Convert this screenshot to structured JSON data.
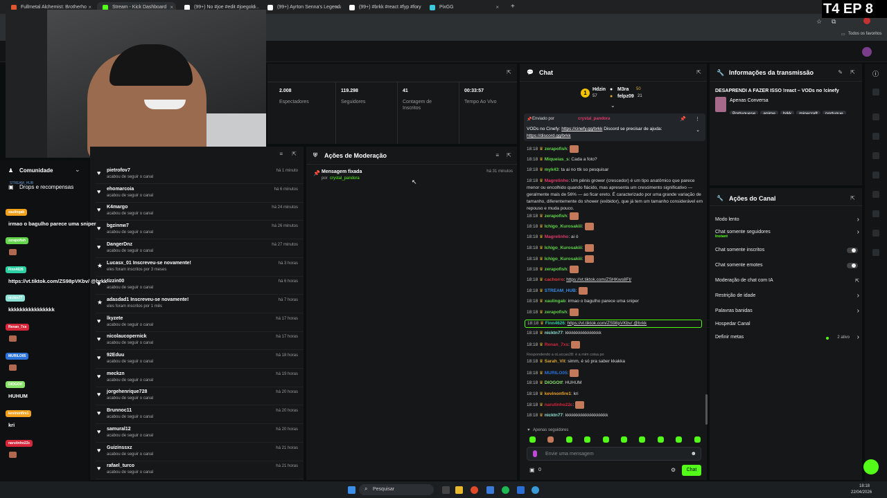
{
  "browser": {
    "tabs": [
      {
        "label": "Fullmetal Alchemist: Brotherho",
        "color": "#e0572f"
      },
      {
        "label": "Stream - Kick Dashboard",
        "color": "#53fc18"
      },
      {
        "label": "(99+) No #joe #edit #joegold...",
        "color": "#ffffff"
      },
      {
        "label": "(99+) Ayrton Senna's Legendar",
        "color": "#ffffff"
      },
      {
        "label": "(99+) #brkk #react #fyp #foryou",
        "color": "#ffffff"
      },
      {
        "label": "PixGG",
        "color": "#3bc9db"
      }
    ],
    "new_tab": "+",
    "bookmarks_label": "Todos os favoritos"
  },
  "overlay": {
    "episode": "T4 EP 8"
  },
  "stats": [
    {
      "value": "2.008",
      "label": "Espectadores"
    },
    {
      "value": "119.298",
      "label": "Seguidores"
    },
    {
      "value": "41",
      "label": "Contagem de Inscritos"
    },
    {
      "value": "00:33:57",
      "label": "Tempo Ao Vivo"
    }
  ],
  "left_sidebar": {
    "community": "Comunidade",
    "drops": "Drops e recompensas",
    "stream_hub": "STREAM_HUB"
  },
  "chat_overlay": [
    {
      "user": "xaulingab",
      "color": "#f2a21c",
      "msg": "irmao o bagulho parece uma sniper"
    },
    {
      "user": "zerapofish",
      "color": "#63d64b",
      "msg": ""
    },
    {
      "user": "Finn4626",
      "color": "#2ed1a3",
      "msg": "https://vt.tiktok.com/ZS98pVKbv/ @brkk"
    },
    {
      "user": "nicktn77",
      "color": "#8fe3d6",
      "msg": "kkkkkkkkkkkkkkkk"
    },
    {
      "user": "Renan_7xs",
      "color": "#d6273a",
      "msg": ""
    },
    {
      "user": "MURILO05",
      "color": "#2b73d8",
      "msg": ""
    },
    {
      "user": "DIOGOtf",
      "color": "#8ae36a",
      "msg": "HUHUM"
    },
    {
      "user": "kevinonfire1",
      "color": "#f2a21c",
      "msg": "kri"
    },
    {
      "user": "narutinho22c",
      "color": "#d6273a",
      "msg": ""
    }
  ],
  "activity": {
    "items": [
      {
        "name": "pietrofov7",
        "sub": "acabou de seguir o canal",
        "time": "há 1 minuto",
        "type": "heart"
      },
      {
        "name": "ehomarcoia",
        "sub": "acabou de seguir o canal",
        "time": "há 6 minutos",
        "type": "heart"
      },
      {
        "name": "K4margo",
        "sub": "acabou de seguir o canal",
        "time": "há 24 minutos",
        "type": "heart"
      },
      {
        "name": "bgzinnw7",
        "sub": "acabou de seguir o canal",
        "time": "há 26 minutos",
        "type": "heart"
      },
      {
        "name": "DangerDnz",
        "sub": "acabou de seguir o canal",
        "time": "há 27 minutos",
        "type": "heart"
      },
      {
        "name": "Lucasx_01 Inscreveu-se novamente!",
        "sub": "eles foram inscritos por 3 meses",
        "time": "há 3 horas",
        "type": "star"
      },
      {
        "name": "tizzin00",
        "sub": "acabou de seguir o canal",
        "time": "há 6 horas",
        "type": "heart"
      },
      {
        "name": "adasdad1 Inscreveu-se novamente!",
        "sub": "eles foram inscritos por 1 mês",
        "time": "há 7 horas",
        "type": "star"
      },
      {
        "name": "lkyzete",
        "sub": "acabou de seguir o canal",
        "time": "há 17 horas",
        "type": "heart"
      },
      {
        "name": "nicolaucopernick",
        "sub": "acabou de seguir o canal",
        "time": "há 17 horas",
        "type": "heart"
      },
      {
        "name": "92Eduu",
        "sub": "acabou de seguir o canal",
        "time": "há 18 horas",
        "type": "heart"
      },
      {
        "name": "meckzn",
        "sub": "acabou de seguir o canal",
        "time": "há 19 horas",
        "type": "heart"
      },
      {
        "name": "jorgehenrique728",
        "sub": "acabou de seguir o canal",
        "time": "há 20 horas",
        "type": "heart"
      },
      {
        "name": "Brunnoc11",
        "sub": "acabou de seguir o canal",
        "time": "há 20 horas",
        "type": "heart"
      },
      {
        "name": "samural12",
        "sub": "acabou de seguir o canal",
        "time": "há 20 horas",
        "type": "heart"
      },
      {
        "name": "Guizinssxz",
        "sub": "acabou de seguir o canal",
        "time": "há 21 horas",
        "type": "heart"
      },
      {
        "name": "rafael_turco",
        "sub": "acabou de seguir o canal",
        "time": "há 21 horas",
        "type": "heart"
      }
    ]
  },
  "moderation": {
    "title": "Ações de Moderação",
    "item_title": "Mensagem fixada",
    "item_by": "por",
    "item_user": "crystal_pandora",
    "item_time": "há 31 minutos"
  },
  "chat": {
    "title": "Chat",
    "leaders": [
      {
        "name": "Hdzin",
        "count": "57",
        "rank": "1"
      },
      {
        "name": "M3ra",
        "count": "50"
      },
      {
        "name": "felpz09",
        "count": "21"
      }
    ],
    "pinned": {
      "label": "Enviado por",
      "user": "crystal_pandora",
      "text": "VODs no Cinefy:",
      "link1": "https://cinefy.gg/brkk",
      "text2": "Discord se precisar de ajuda:",
      "link2": "https://discord.gg/brkk"
    },
    "messages": [
      {
        "time": "18:18",
        "user": "zerapofish",
        "color": "#63d64b",
        "text": "",
        "emote": true
      },
      {
        "time": "18:18",
        "user": "Miqueias_s",
        "color": "#63d64b",
        "text": "Cada a foto?"
      },
      {
        "time": "18:18",
        "user": "myk43",
        "color": "#63d64b",
        "text": "ta ai no ttk so pesquisar"
      },
      {
        "time": "18:18",
        "user": "Magrelinho",
        "color": "#e03a6a",
        "text": "Um pênis grower (crescedor) é um tipo anatômico que parece menor ou encolhido quando flácido, mas apresenta um crescimento significativo — geralmente mais de 56% — ao ficar ereto. É caracterizado por uma grande variação de tamanho, diferentemente do shower (exibidor), que já tem um tamanho considerável em repouso e muda pouco."
      },
      {
        "time": "18:18",
        "user": "zerapofish",
        "color": "#63d64b",
        "text": "",
        "emote": true
      },
      {
        "time": "18:18",
        "user": "Ichigo_Kurosakiii",
        "color": "#63d64b",
        "text": "",
        "emote": true
      },
      {
        "time": "18:18",
        "user": "Magrelinho",
        "color": "#e03a6a",
        "text": "ai ó"
      },
      {
        "time": "18:18",
        "user": "Ichigo_Kurosakiii",
        "color": "#63d64b",
        "text": "",
        "emote": true
      },
      {
        "time": "18:18",
        "user": "Ichigo_Kurosakiii",
        "color": "#63d64b",
        "text": "",
        "emote": true
      },
      {
        "time": "18:18",
        "user": "zerapofish",
        "color": "#63d64b",
        "text": "",
        "emote": true
      },
      {
        "time": "18:18",
        "user": "cachorro",
        "color": "#e03a3a",
        "text": "https://vt.tiktok.com/ZSHKws8Ft/"
      },
      {
        "time": "18:18",
        "user": "STREAM_HUB",
        "color": "#3a8ee8",
        "text": "",
        "emote": true
      },
      {
        "time": "18:18",
        "user": "xaulingab",
        "color": "#63d64b",
        "text": "irmao o bagulho parece uma sniper"
      },
      {
        "time": "18:18",
        "user": "zerapofish",
        "color": "#63d64b",
        "text": "",
        "emote": true
      },
      {
        "time": "18:18",
        "user": "Finn4626",
        "color": "#2ed1a3",
        "text": "https://vt.tiktok.com/ZS98pVKbv/ @brkk",
        "highlight": true
      },
      {
        "time": "18:18",
        "user": "nicktn77",
        "color": "#8fe3d6",
        "text": "kkkkkkkkkkkkkkkk"
      },
      {
        "time": "18:18",
        "user": "Renan_7xs",
        "color": "#d6273a",
        "text": "",
        "emote": true
      },
      {
        "time": "",
        "user": "",
        "color": "#999999",
        "text": "Respondendo a oLuccas28: é a mim coisa po",
        "reply": true
      },
      {
        "time": "18:18",
        "user": "Sarah_Vit",
        "color": "#e0a830",
        "text": "simm, é só pra saber kkakka"
      },
      {
        "time": "18:18",
        "user": "MURILO05",
        "color": "#2b73d8",
        "text": "",
        "emote": true
      },
      {
        "time": "18:18",
        "user": "DIOGOtf",
        "color": "#8ae36a",
        "text": "HUHUM"
      },
      {
        "time": "18:18",
        "user": "kevinonfire1",
        "color": "#f2a21c",
        "text": "kri"
      },
      {
        "time": "18:18",
        "user": "narutinho22c",
        "color": "#d6273a",
        "text": "",
        "emote": true
      },
      {
        "time": "18:18",
        "user": "nicktn77",
        "color": "#8fe3d6",
        "text": "kkkkkkkkkkkkkkkkkkk"
      }
    ],
    "followers_only": "Apenas seguidores",
    "input_placeholder": "Envie uma mensagem",
    "count": "0",
    "send": "Chat"
  },
  "stream_info": {
    "title": "Informações da transmissão",
    "stream_title": "DESAPRENDI A FAZER ISSO !react – VODs no !cinefy",
    "category": "Apenas Conversa",
    "tags": [
      "Portuguese",
      "anime",
      "brkk",
      "minecraft",
      "portugue"
    ]
  },
  "channel_actions": {
    "title": "Ações do Canal",
    "items": [
      {
        "label": "Modo lento",
        "control": "arrow"
      },
      {
        "label": "Chat somente seguidores",
        "sub": "Instant",
        "control": "arrow"
      },
      {
        "label": "Chat somente inscritos",
        "control": "toggle"
      },
      {
        "label": "Chat somente emotes",
        "control": "toggle"
      },
      {
        "label": "Moderação de chat com IA",
        "control": "ext"
      },
      {
        "label": "Restrição de idade",
        "control": "arrow"
      },
      {
        "label": "Palavras banidas",
        "control": "arrow"
      },
      {
        "label": "Hospedar Canal",
        "control": "none"
      },
      {
        "label": "Definir metas",
        "control": "arrow",
        "badge": "2 ativo"
      }
    ]
  },
  "taskbar": {
    "search": "Pesquisar",
    "time": "18:18",
    "date": "22/04/2026"
  }
}
